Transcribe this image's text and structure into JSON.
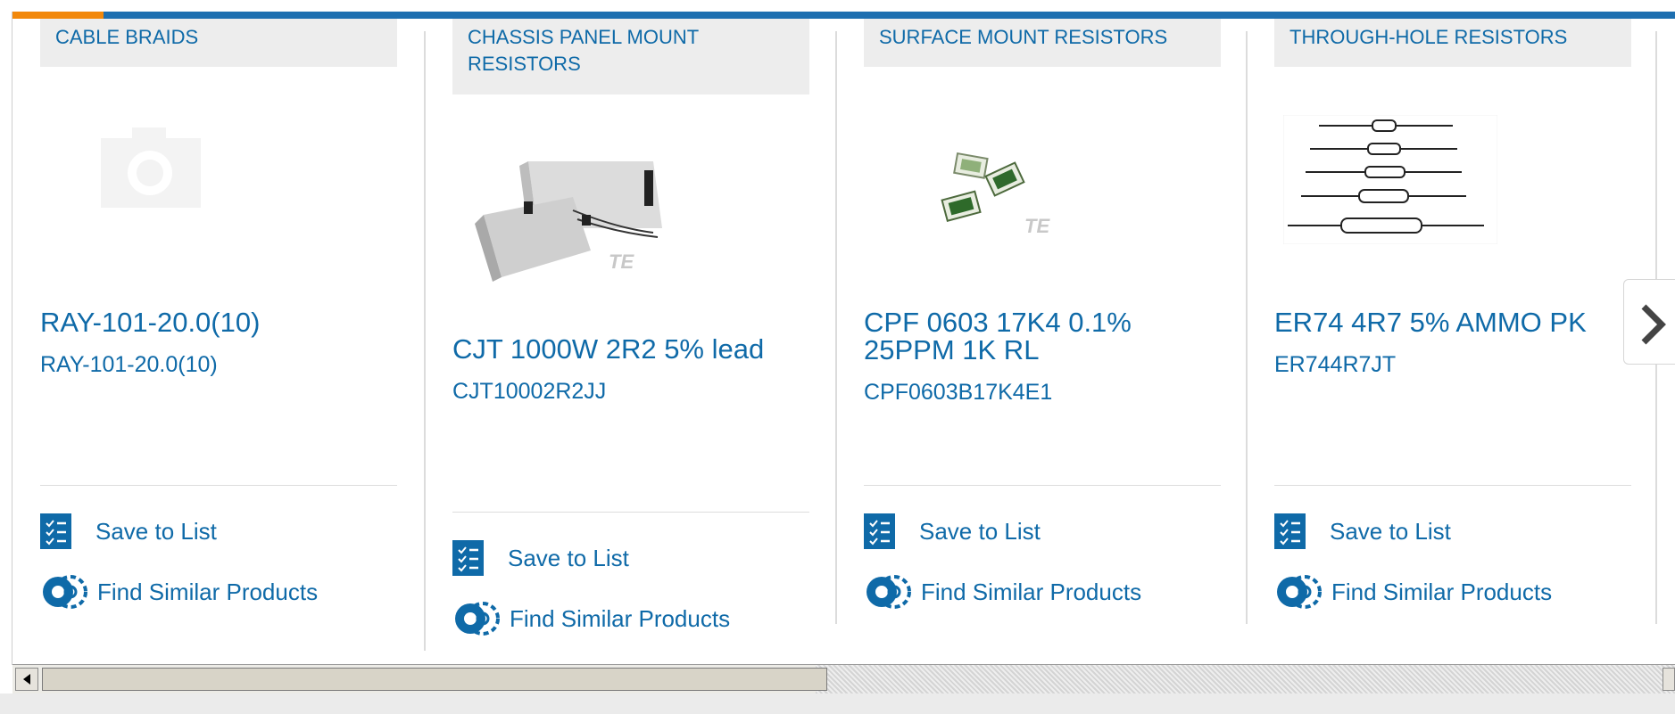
{
  "products": [
    {
      "category": "CABLE BRAIDS",
      "title": "RAY-101-20.0(10)",
      "part_number": "RAY-101-20.0(10)",
      "image": "camera-placeholder-icon",
      "save_label": "Save to List",
      "similar_label": "Find Similar Products"
    },
    {
      "category": "CHASSIS PANEL MOUNT RESISTORS",
      "title": "CJT 1000W 2R2 5% lead",
      "part_number": "CJT10002R2JJ",
      "image": "chassis-resistor-photo",
      "watermark": "TE",
      "save_label": "Save to List",
      "similar_label": "Find Similar Products"
    },
    {
      "category": "SURFACE MOUNT RESISTORS",
      "title": "CPF 0603 17K4 0.1% 25PPM 1K RL",
      "part_number": "CPF0603B17K4E1",
      "image": "smd-resistor-photo",
      "watermark": "TE",
      "save_label": "Save to List",
      "similar_label": "Find Similar Products"
    },
    {
      "category": "THROUGH-HOLE RESISTORS",
      "title": "ER74 4R7 5% AMMO PK",
      "part_number": "ER744R7JT",
      "image": "through-hole-resistors-photo",
      "save_label": "Save to List",
      "similar_label": "Find Similar Products"
    }
  ],
  "carousel": {
    "next_icon": "chevron-right-icon"
  },
  "colors": {
    "brand_blue": "#0f6aa8",
    "accent_orange": "#f2880b",
    "category_bg": "#ededed"
  }
}
